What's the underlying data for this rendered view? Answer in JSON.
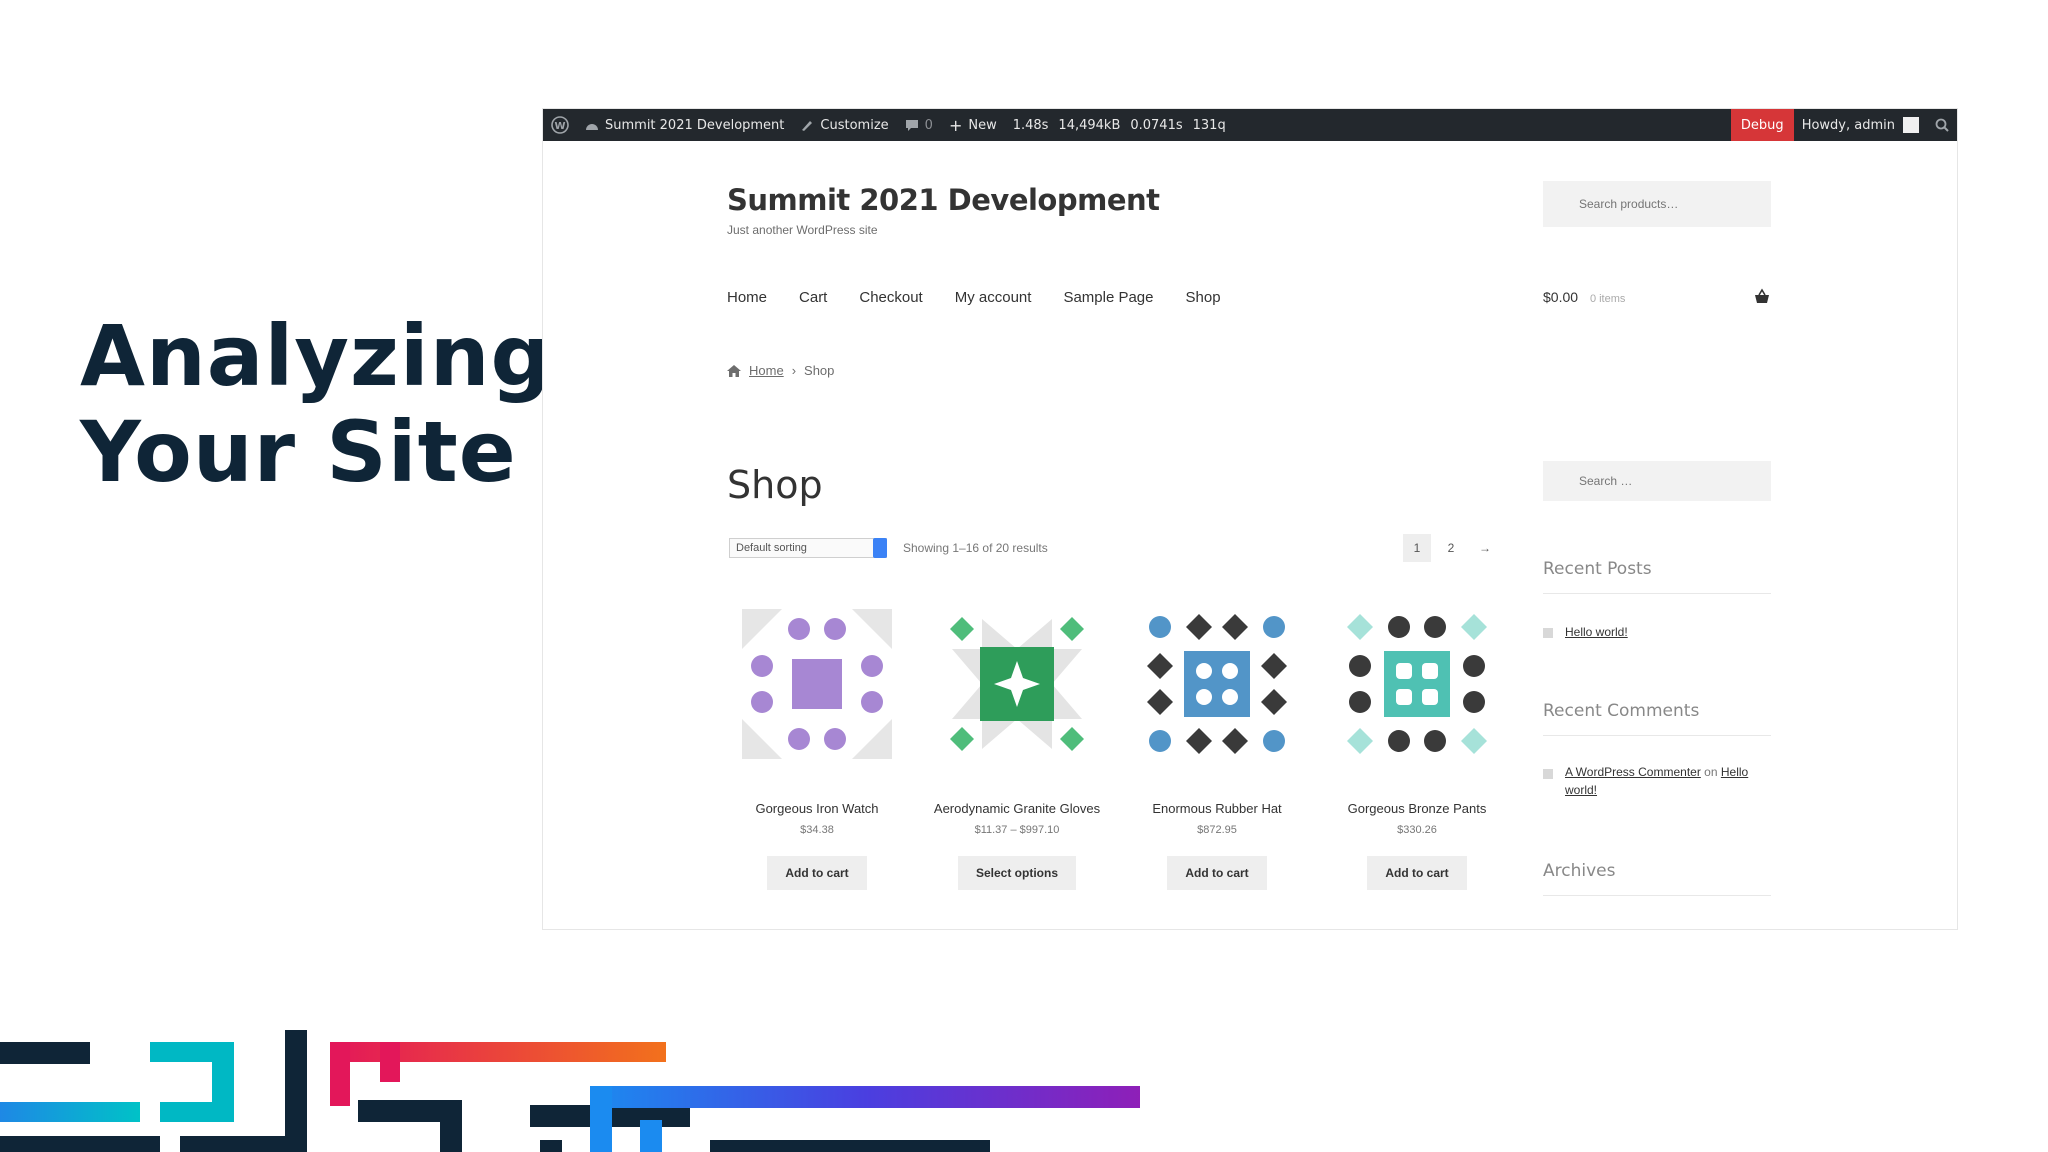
{
  "slide": {
    "heading_line1": "Analyzing",
    "heading_line2": "Your Site"
  },
  "admin_bar": {
    "wp_logo": "wordpress-icon",
    "site_name": "Summit 2021 Development",
    "customize": "Customize",
    "comments_count": "0",
    "new": "New",
    "stat_time": "1.48s",
    "stat_memory": "14,494kB",
    "stat_query_time": "0.0741s",
    "stat_queries": "131q",
    "debug": "Debug",
    "howdy": "Howdy, admin",
    "colors": {
      "bar": "#23282d",
      "debug": "#d63638"
    }
  },
  "site": {
    "title": "Summit 2021 Development",
    "description": "Just another WordPress site",
    "search_placeholder": "Search products…"
  },
  "nav": {
    "items": [
      "Home",
      "Cart",
      "Checkout",
      "My account",
      "Sample Page",
      "Shop"
    ],
    "cart_total": "$0.00",
    "cart_items": "0 items"
  },
  "breadcrumb": {
    "home": "Home",
    "current": "Shop"
  },
  "shop": {
    "title": "Shop",
    "sort_selected": "Default sorting",
    "result_count": "Showing 1–16 of 20 results",
    "pages": [
      "1",
      "2",
      "→"
    ],
    "products": [
      {
        "name": "Gorgeous Iron Watch",
        "price": "$34.38",
        "button": "Add to cart",
        "accent": "#a787d3"
      },
      {
        "name": "Aerodynamic Granite Gloves",
        "price": "$11.37 – $997.10",
        "button": "Select options",
        "accent": "#2e9d5a"
      },
      {
        "name": "Enormous Rubber Hat",
        "price": "$872.95",
        "button": "Add to cart",
        "accent": "#5295c8"
      },
      {
        "name": "Gorgeous Bronze Pants",
        "price": "$330.26",
        "button": "Add to cart",
        "accent": "#4fc1b3"
      }
    ]
  },
  "sidebar": {
    "search_placeholder": "Search …",
    "recent_posts_title": "Recent Posts",
    "recent_post": "Hello world!",
    "recent_comments_title": "Recent Comments",
    "comment_author": "A WordPress Commenter",
    "comment_on": "on",
    "comment_post": "Hello world!",
    "archives_title": "Archives"
  }
}
